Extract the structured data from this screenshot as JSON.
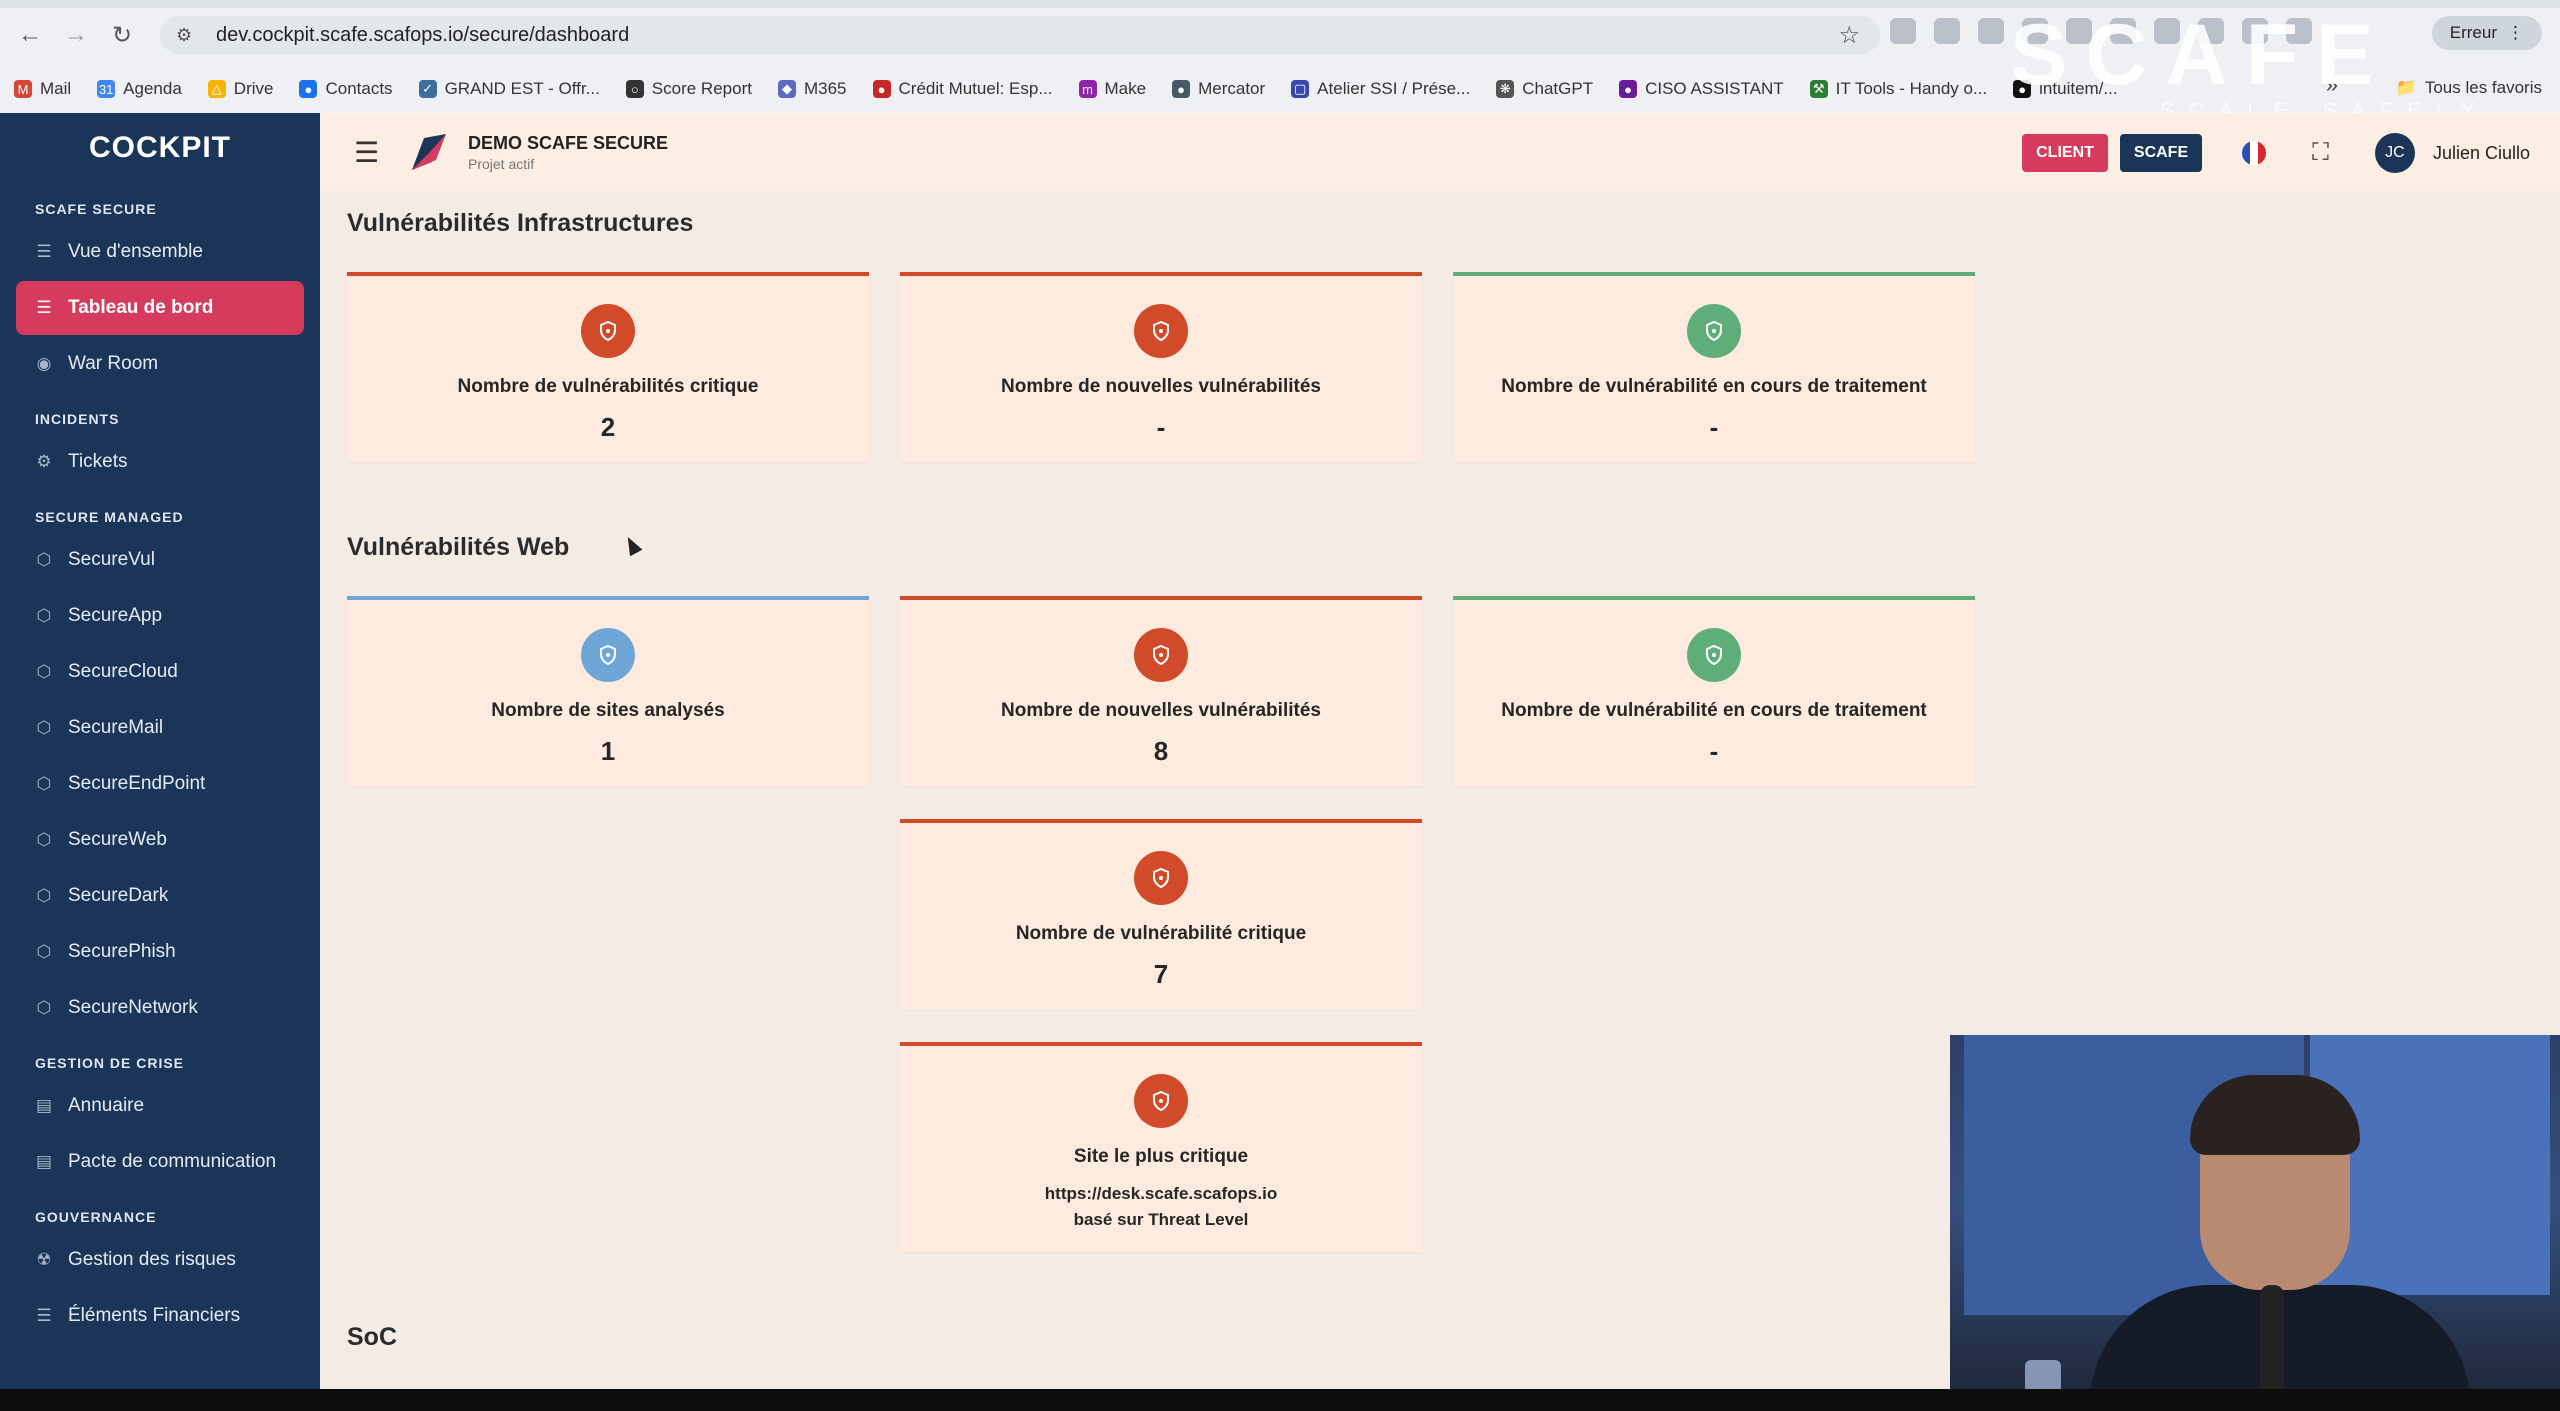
{
  "browser": {
    "url": "dev.cockpit.scafe.scafops.io/secure/dashboard",
    "error_label": "Erreur",
    "bookmarks": [
      "Mail",
      "Agenda",
      "Drive",
      "Contacts",
      "GRAND EST - Offr...",
      "Score Report",
      "M365",
      "Crédit Mutuel: Esp...",
      "Make",
      "Mercator",
      "Atelier SSI / Prése...",
      "ChatGPT",
      "CISO ASSISTANT",
      "IT Tools - Handy o...",
      "intuitem/..."
    ],
    "bookmarks_all": "Tous les favoris"
  },
  "watermark": {
    "big": "SCAFE",
    "small": "SCALE SAFELY"
  },
  "sidebar": {
    "logo": "COCKPIT",
    "sections": [
      {
        "title": "SCAFE SECURE",
        "items": [
          {
            "label": "Vue d'ensemble",
            "icon": "document-icon"
          },
          {
            "label": "Tableau de bord",
            "icon": "document-icon",
            "active": true
          },
          {
            "label": "War Room",
            "icon": "broadcast-icon"
          }
        ]
      },
      {
        "title": "INCIDENTS",
        "items": [
          {
            "label": "Tickets",
            "icon": "gear-icon"
          }
        ]
      },
      {
        "title": "SECURE MANAGED",
        "items": [
          {
            "label": "SecureVul",
            "icon": "shield-icon"
          },
          {
            "label": "SecureApp",
            "icon": "shield-icon"
          },
          {
            "label": "SecureCloud",
            "icon": "shield-icon"
          },
          {
            "label": "SecureMail",
            "icon": "shield-icon"
          },
          {
            "label": "SecureEndPoint",
            "icon": "shield-icon"
          },
          {
            "label": "SecureWeb",
            "icon": "shield-icon"
          },
          {
            "label": "SecureDark",
            "icon": "shield-icon"
          },
          {
            "label": "SecurePhish",
            "icon": "shield-icon"
          },
          {
            "label": "SecureNetwork",
            "icon": "shield-icon"
          }
        ]
      },
      {
        "title": "GESTION DE CRISE",
        "items": [
          {
            "label": "Annuaire",
            "icon": "book-icon"
          },
          {
            "label": "Pacte de communication",
            "icon": "book-icon"
          }
        ]
      },
      {
        "title": "GOUVERNANCE",
        "items": [
          {
            "label": "Gestion des risques",
            "icon": "hazard-icon"
          },
          {
            "label": "Éléments Financiers",
            "icon": "document-icon"
          }
        ]
      }
    ]
  },
  "topbar": {
    "project_name": "DEMO SCAFE SECURE",
    "project_sub": "Projet actif",
    "client_label": "CLIENT",
    "scafe_label": "SCAFE",
    "avatar_initials": "JC",
    "user_name": "Julien Ciullo"
  },
  "infra": {
    "title": "Vulnérabilités Infrastructures",
    "cards": [
      {
        "label": "Nombre de vulnérabilités critique",
        "value": "2"
      },
      {
        "label": "Nombre de nouvelles vulnérabilités",
        "value": "-"
      },
      {
        "label": "Nombre de vulnérabilité en cours de traitement",
        "value": "-"
      }
    ]
  },
  "web": {
    "title": "Vulnérabilités Web",
    "cards": [
      {
        "label": "Nombre de sites analysés",
        "value": "1"
      },
      {
        "label": "Nombre de nouvelles vulnérabilités",
        "value": "8"
      },
      {
        "label": "Nombre de vulnérabilité en cours de traitement",
        "value": "-"
      },
      {
        "label": "Nombre de vulnérabilité critique",
        "value": "7"
      },
      {
        "label": "Site le plus critique",
        "link": "https://desk.scafe.scafops.io",
        "note": "basé sur Threat Level"
      }
    ]
  },
  "soc": {
    "title": "SoC"
  },
  "colors": {
    "sidebar": "#1b3558",
    "accent": "#d63a5d",
    "danger": "#d14a2a",
    "ok": "#5fae7a",
    "info": "#6fa6d8",
    "content_bg": "#f4ebe4"
  }
}
